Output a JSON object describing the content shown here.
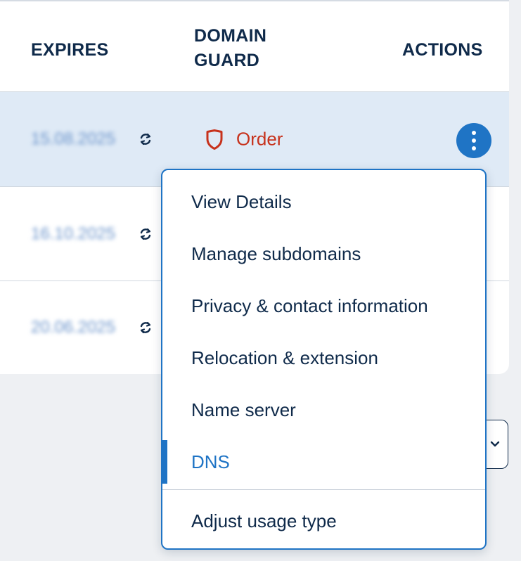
{
  "table": {
    "headers": {
      "expires": "EXPIRES",
      "domain_guard": "DOMAIN GUARD",
      "actions": "ACTIONS"
    },
    "rows": [
      {
        "expires": "15.08.2025",
        "guard_label": "Order"
      },
      {
        "expires": "16.10.2025"
      },
      {
        "expires": "20.06.2025"
      }
    ]
  },
  "menu": {
    "items": [
      "View Details",
      "Manage subdomains",
      "Privacy & contact information",
      "Relocation & extension",
      "Name server",
      "DNS",
      "Adjust usage type"
    ],
    "active_item": "DNS"
  },
  "colors": {
    "primary": "#1f74c5",
    "text": "#0f2a4a",
    "guard_red": "#c7321c",
    "selected_row": "#dfeaf6"
  },
  "icons": {
    "renew": "renew-icon",
    "guard": "shield-icon",
    "actions": "kebab-menu-icon",
    "select": "chevron-down-icon"
  }
}
